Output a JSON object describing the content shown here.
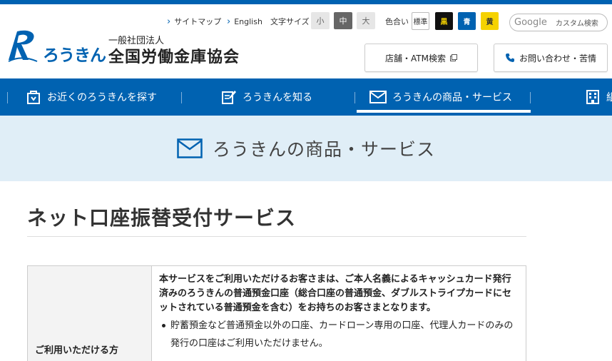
{
  "brand": {
    "logo_text": "ろうきん",
    "org_type": "一般社団法人",
    "org_name": "全国労働金庫協会",
    "color": "#0062b1"
  },
  "utility": {
    "sitemap": "サイトマップ",
    "english": "English",
    "font_size_label": "文字サイズ",
    "font_sizes": [
      "小",
      "中",
      "大"
    ],
    "font_size_selected": "中",
    "color_label": "色合い",
    "colors": [
      {
        "label": "標準",
        "bg": "#ffffff",
        "fg": "#333333"
      },
      {
        "label": "黒",
        "bg": "#111111",
        "fg": "#f5d200"
      },
      {
        "label": "青",
        "bg": "#0062b1",
        "fg": "#ffffff"
      },
      {
        "label": "黄",
        "bg": "#f5d200",
        "fg": "#333333"
      }
    ],
    "search_brand": "Google",
    "search_placeholder": "カスタム検索"
  },
  "header_buttons": {
    "store_atm": "店舗・ATM検索",
    "contact": "お問い合わせ・苦情"
  },
  "nav": {
    "items": [
      {
        "label": "お近くのろうきんを探す"
      },
      {
        "label": "ろうきんを知る"
      },
      {
        "label": "ろうきんの商品・サービス"
      },
      {
        "label": "組"
      }
    ],
    "active_index": 2
  },
  "banner": {
    "title": "ろうきんの商品・サービス"
  },
  "page": {
    "title": "ネット口座振替受付サービス"
  },
  "table": {
    "row_header": "ご利用いただける方",
    "lead": "本サービスをご利用いただけるお客さまは、ご本人名義によるキャッシュカード発行済みのろうきんの普通預金口座（総合口座の普通預金、ダブルストライプカードにセットされている普通預金を含む）をお持ちのお客さまとなります。",
    "bullets": [
      "貯蓄預金など普通預金以外の口座、カードローン専用の口座、代理人カードのみの発行の口座はご利用いただけません。"
    ]
  }
}
